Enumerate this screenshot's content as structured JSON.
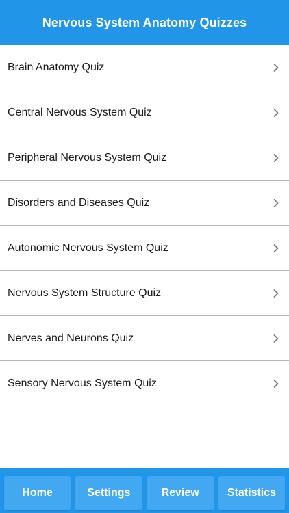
{
  "header": {
    "title": "Nervous System Anatomy Quizzes"
  },
  "colors": {
    "accent": "#2196e8",
    "tab_button": "#42a8f2",
    "divider": "#b8b8b8"
  },
  "quizzes": [
    {
      "label": "Brain Anatomy Quiz",
      "icon": "chevron-right-icon"
    },
    {
      "label": "Central Nervous System Quiz",
      "icon": "chevron-right-icon"
    },
    {
      "label": "Peripheral Nervous System Quiz",
      "icon": "chevron-right-icon"
    },
    {
      "label": "Disorders and Diseases Quiz",
      "icon": "chevron-right-icon"
    },
    {
      "label": "Autonomic Nervous System Quiz",
      "icon": "chevron-right-icon"
    },
    {
      "label": "Nervous System Structure Quiz",
      "icon": "chevron-right-icon"
    },
    {
      "label": "Nerves and Neurons Quiz",
      "icon": "chevron-right-icon"
    },
    {
      "label": "Sensory Nervous System Quiz",
      "icon": "chevron-right-icon"
    }
  ],
  "tabs": [
    {
      "label": "Home"
    },
    {
      "label": "Settings"
    },
    {
      "label": "Review"
    },
    {
      "label": "Statistics"
    }
  ]
}
